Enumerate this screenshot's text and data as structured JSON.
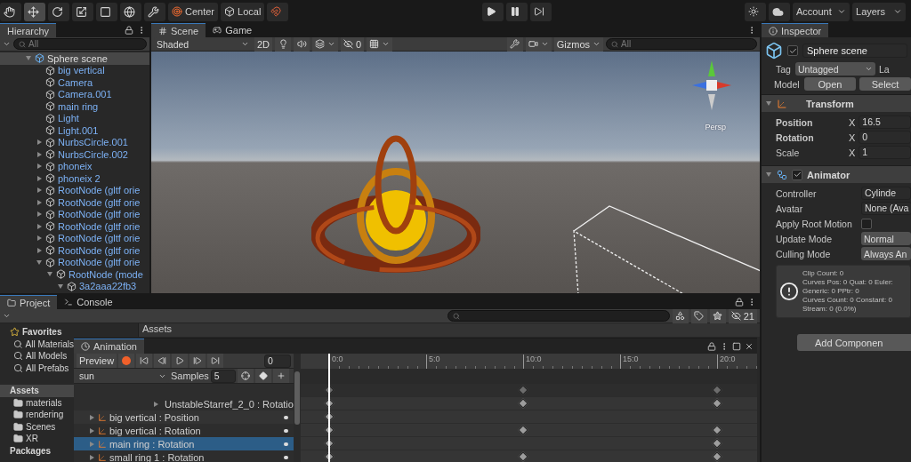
{
  "toolbar": {
    "tools": [
      {
        "kind": "hand",
        "selected": false
      },
      {
        "kind": "move",
        "selected": true
      },
      {
        "kind": "rotate",
        "selected": false
      },
      {
        "kind": "scale",
        "selected": false
      },
      {
        "kind": "rect",
        "selected": false
      },
      {
        "kind": "transform",
        "selected": false
      },
      {
        "kind": "custom",
        "selected": false
      }
    ],
    "pivot_buttons": [
      {
        "kind": "pivot",
        "label": "Center"
      },
      {
        "kind": "space",
        "label": "Local"
      }
    ],
    "account": "Account",
    "layers": "Layers"
  },
  "hierarchy": {
    "title": "Hierarchy",
    "search": {
      "placeholder": "All"
    },
    "items": [
      {
        "label": "Sphere scene",
        "kind": "scene",
        "selected": true,
        "expanded": true,
        "children": [
          {
            "label": "big vertical",
            "kind": "prefab",
            "selected": false
          },
          {
            "label": "Camera",
            "kind": "prefab",
            "selected": false
          },
          {
            "label": "Camera.001",
            "kind": "prefab",
            "selected": false
          },
          {
            "label": "main ring",
            "kind": "prefab",
            "selected": false
          },
          {
            "label": "Light",
            "kind": "prefab",
            "selected": false
          },
          {
            "label": "Light.001",
            "kind": "prefab",
            "selected": false
          },
          {
            "label": "NurbsCircle.001",
            "kind": "prefab",
            "selected": false,
            "expanded": false
          },
          {
            "label": "NurbsCircle.002",
            "kind": "prefab",
            "selected": false,
            "expanded": false
          },
          {
            "label": "phoneix",
            "kind": "prefab",
            "selected": false,
            "expanded": false
          },
          {
            "label": "phoneix 2",
            "kind": "prefab",
            "selected": false,
            "expanded": false
          },
          {
            "label": "RootNode (gltf orie",
            "kind": "prefab",
            "selected": false,
            "expanded": false
          },
          {
            "label": "RootNode (gltf orie",
            "kind": "prefab",
            "selected": false,
            "expanded": false
          },
          {
            "label": "RootNode (gltf orie",
            "kind": "prefab",
            "selected": false,
            "expanded": false
          },
          {
            "label": "RootNode (gltf orie",
            "kind": "prefab",
            "selected": false,
            "expanded": false
          },
          {
            "label": "RootNode (gltf orie",
            "kind": "prefab",
            "selected": false,
            "expanded": false
          },
          {
            "label": "RootNode (gltf orie",
            "kind": "prefab",
            "selected": false,
            "expanded": false
          },
          {
            "label": "RootNode (gltf orie",
            "kind": "prefab",
            "selected": false,
            "expanded": true,
            "children": [
              {
                "label": "RootNode (mode",
                "kind": "prefab",
                "selected": false,
                "expanded": true,
                "children": [
                  {
                    "label": "3a2aaa22fb3",
                    "kind": "prefab",
                    "selected": false,
                    "expanded": true
                  }
                ]
              }
            ]
          }
        ]
      }
    ]
  },
  "scene": {
    "tabs": [
      {
        "label": "Scene",
        "kind": "scene",
        "selected": true
      },
      {
        "label": "Game",
        "kind": "game",
        "selected": false
      }
    ],
    "shading": "Shaded",
    "mode_2d": "2D",
    "hidden_count": "0",
    "gizmos": "Gizmos",
    "search": {
      "placeholder": "All"
    },
    "view_label": "Persp"
  },
  "inspector": {
    "title": "Inspector",
    "object": {
      "name": "Sphere scene",
      "active": true,
      "tag_label": "Tag",
      "tag": "Untagged",
      "layer_label": "La",
      "model_label": "Model",
      "model_buttons": [
        "Open",
        "Select"
      ]
    },
    "components": [
      {
        "kind": "transform",
        "title": "Transform",
        "expanded": true,
        "rows": [
          {
            "label": "Position",
            "axis": "X",
            "value": "16.5",
            "overridden": true
          },
          {
            "label": "Rotation",
            "axis": "X",
            "value": "0",
            "overridden": true
          },
          {
            "label": "Scale",
            "axis": "X",
            "value": "1",
            "overridden": false
          }
        ]
      },
      {
        "kind": "animator",
        "title": "Animator",
        "expanded": true,
        "enabled": true,
        "fields": [
          {
            "label": "Controller",
            "kind": "object",
            "value": "Cylinde"
          },
          {
            "label": "Avatar",
            "kind": "object",
            "value": "None (Ava"
          },
          {
            "label": "Apply Root Motion",
            "kind": "checkbox",
            "checked": false
          },
          {
            "label": "Update Mode",
            "kind": "dropdown",
            "value": "Normal"
          },
          {
            "label": "Culling Mode",
            "kind": "dropdown",
            "value": "Always An"
          }
        ],
        "info": [
          "Clip Count: 0",
          "Curves Pos: 0 Quat: 0 Euler:",
          "Generic: 0 PPtr: 0",
          "Curves Count: 0 Constant: 0",
          "Stream: 0 (0.0%)"
        ]
      }
    ],
    "add_button": "Add Componen"
  },
  "project": {
    "tabs": [
      {
        "label": "Project",
        "kind": "project",
        "selected": true
      },
      {
        "label": "Console",
        "kind": "console",
        "selected": false
      }
    ],
    "filter_count": "21",
    "breadcrumb": "Assets",
    "tree": [
      {
        "label": "Favorites",
        "kind": "favorites",
        "selected": false,
        "children": [
          {
            "label": "All Materials",
            "kind": "search",
            "selected": false
          },
          {
            "label": "All Models",
            "kind": "search",
            "selected": false
          },
          {
            "label": "All Prefabs",
            "kind": "search",
            "selected": false
          }
        ]
      },
      {
        "label": "Assets",
        "kind": "root",
        "selected": true,
        "children": [
          {
            "label": "materials",
            "kind": "folder",
            "selected": false
          },
          {
            "label": "rendering",
            "kind": "folder",
            "selected": false
          },
          {
            "label": "Scenes",
            "kind": "folder",
            "selected": false
          },
          {
            "label": "XR",
            "kind": "folder",
            "selected": false
          }
        ]
      },
      {
        "label": "Packages",
        "kind": "root",
        "selected": false
      }
    ]
  },
  "animation": {
    "title": "Animation",
    "preview": "Preview",
    "frame": "0",
    "clip": "sun",
    "samples_label": "Samples",
    "samples": "5",
    "ruler": [
      "0:0",
      "5:0",
      "10:0",
      "15:0",
      "20:0"
    ],
    "summary_keys": [
      true,
      true,
      true
    ],
    "tracks": [
      {
        "label": "UnstableStarref_2_0 : Rotatio",
        "kind": "child",
        "selected": false,
        "keys": [
          true,
          true,
          true
        ]
      },
      {
        "label": "big vertical : Position",
        "kind": "track",
        "selected": false,
        "keys": [
          true,
          false,
          false
        ]
      },
      {
        "label": "big vertical : Rotation",
        "kind": "track",
        "selected": false,
        "keys": [
          true,
          true,
          true
        ]
      },
      {
        "label": "main ring : Rotation",
        "kind": "track",
        "selected": true,
        "keys": [
          true,
          false,
          true
        ]
      },
      {
        "label": "small ring 1 : Rotation",
        "kind": "track",
        "selected": false,
        "keys": [
          true,
          true,
          true
        ]
      }
    ]
  }
}
